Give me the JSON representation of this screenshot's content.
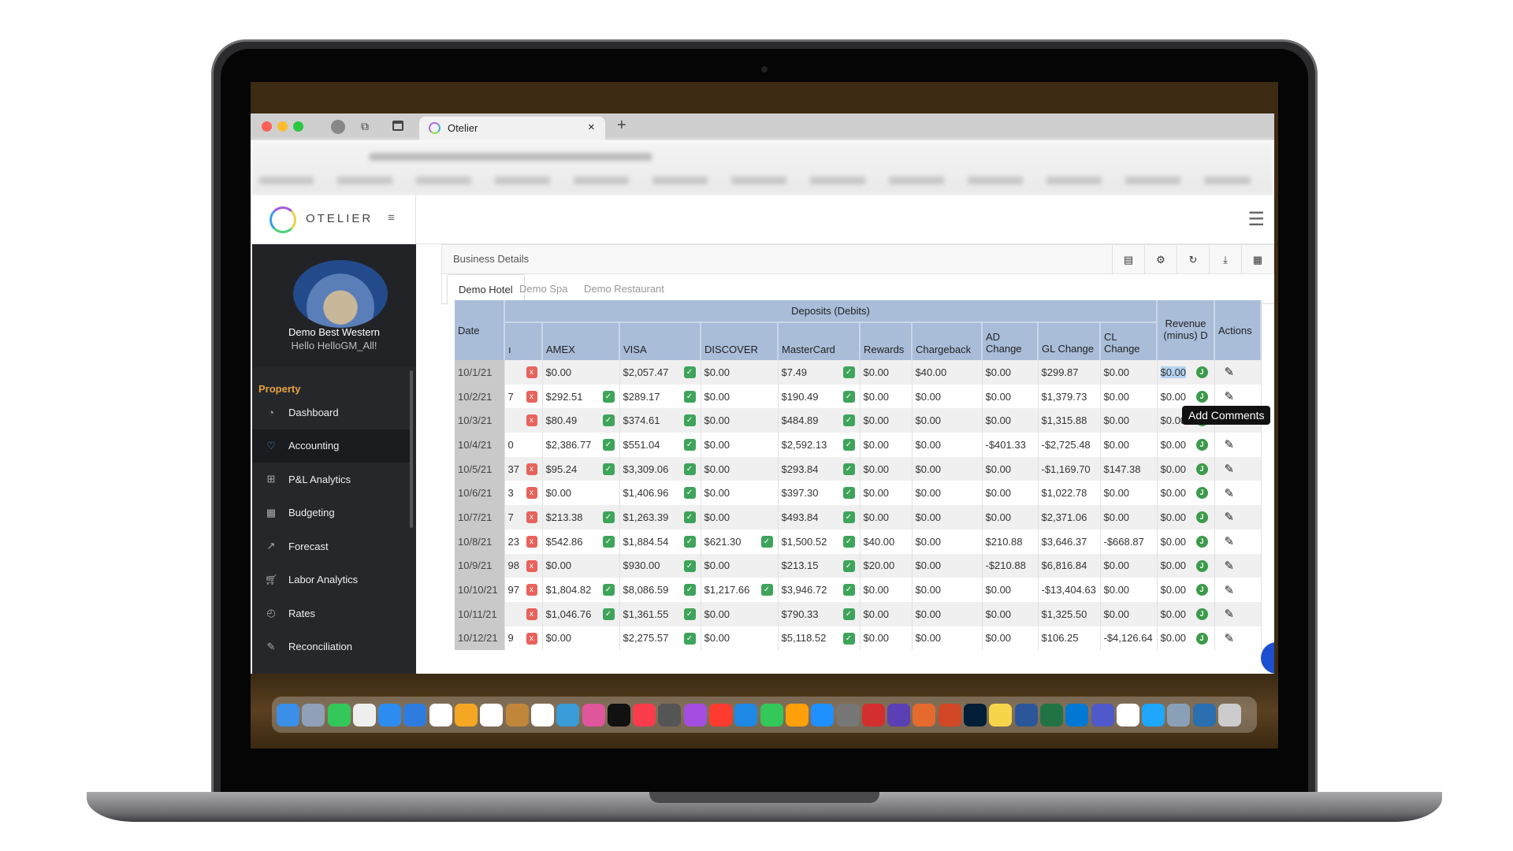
{
  "browser": {
    "tab_title": "Otelier",
    "close": "×",
    "new_tab": "+"
  },
  "app": {
    "logo_text": "OTELIER",
    "menu_icon": "≡"
  },
  "sidebar": {
    "property_name": "Demo Best Western",
    "greeting": "Hello HelloGM_All!",
    "section": "Property",
    "items": [
      {
        "label": "Dashboard",
        "icon": "gauge-icon"
      },
      {
        "label": "Accounting",
        "icon": "handshake-icon",
        "active": true
      },
      {
        "label": "P&L Analytics",
        "icon": "gift-icon"
      },
      {
        "label": "Budgeting",
        "icon": "grid-icon"
      },
      {
        "label": "Forecast",
        "icon": "chart-line-icon"
      },
      {
        "label": "Labor Analytics",
        "icon": "cart-icon"
      },
      {
        "label": "Rates",
        "icon": "pie-icon"
      },
      {
        "label": "Reconciliation",
        "icon": "edit-icon"
      }
    ]
  },
  "panel": {
    "title": "Business Details",
    "tabs": [
      "Demo Hotel",
      "Demo Spa",
      "Demo Restaurant"
    ],
    "active_tab": "Demo Hotel"
  },
  "table": {
    "group_header": "Deposits (Debits)",
    "headers": {
      "date": "Date",
      "partial": "ı",
      "amex": "AMEX",
      "visa": "VISA",
      "discover": "DISCOVER",
      "mastercard": "MasterCard",
      "rewards": "Rewards",
      "chargeback": "Chargeback",
      "ad": "AD Change",
      "gl": "GL Change",
      "cl": "CL Change",
      "revenue": "Revenue (minus) D",
      "actions": "Actions"
    },
    "rows": [
      {
        "date": "10/1/21",
        "p": "",
        "px": true,
        "amex": "$0.00",
        "amex_ok": false,
        "visa": "$2,057.47",
        "visa_ok": true,
        "disc": "$0.00",
        "disc_ok": false,
        "mc": "$7.49",
        "mc_ok": true,
        "rewards": "$0.00",
        "cb": "$40.00",
        "ad": "$0.00",
        "gl": "$299.87",
        "cl": "$0.00",
        "rev": "$0.00"
      },
      {
        "date": "10/2/21",
        "p": "7",
        "px": true,
        "amex": "$292.51",
        "amex_ok": true,
        "visa": "$289.17",
        "visa_ok": true,
        "disc": "$0.00",
        "disc_ok": false,
        "mc": "$190.49",
        "mc_ok": true,
        "rewards": "$0.00",
        "cb": "$0.00",
        "ad": "$0.00",
        "gl": "$1,379.73",
        "cl": "$0.00",
        "rev": "$0.00"
      },
      {
        "date": "10/3/21",
        "p": "",
        "px": true,
        "amex": "$80.49",
        "amex_ok": true,
        "visa": "$374.61",
        "visa_ok": true,
        "disc": "$0.00",
        "disc_ok": false,
        "mc": "$484.89",
        "mc_ok": true,
        "rewards": "$0.00",
        "cb": "$0.00",
        "ad": "$0.00",
        "gl": "$1,315.88",
        "cl": "$0.00",
        "rev": "$0.00"
      },
      {
        "date": "10/4/21",
        "p": "0",
        "px": false,
        "amex": "$2,386.77",
        "amex_ok": true,
        "visa": "$551.04",
        "visa_ok": true,
        "disc": "$0.00",
        "disc_ok": false,
        "mc": "$2,592.13",
        "mc_ok": true,
        "rewards": "$0.00",
        "cb": "$0.00",
        "ad": "-$401.33",
        "gl": "-$2,725.48",
        "cl": "$0.00",
        "rev": "$0.00"
      },
      {
        "date": "10/5/21",
        "p": "37",
        "px": true,
        "amex": "$95.24",
        "amex_ok": true,
        "visa": "$3,309.06",
        "visa_ok": true,
        "disc": "$0.00",
        "disc_ok": false,
        "mc": "$293.84",
        "mc_ok": true,
        "rewards": "$0.00",
        "cb": "$0.00",
        "ad": "$0.00",
        "gl": "-$1,169.70",
        "cl": "$147.38",
        "rev": "$0.00"
      },
      {
        "date": "10/6/21",
        "p": "3",
        "px": true,
        "amex": "$0.00",
        "amex_ok": false,
        "visa": "$1,406.96",
        "visa_ok": true,
        "disc": "$0.00",
        "disc_ok": false,
        "mc": "$397.30",
        "mc_ok": true,
        "rewards": "$0.00",
        "cb": "$0.00",
        "ad": "$0.00",
        "gl": "$1,022.78",
        "cl": "$0.00",
        "rev": "$0.00"
      },
      {
        "date": "10/7/21",
        "p": "7",
        "px": true,
        "amex": "$213.38",
        "amex_ok": true,
        "visa": "$1,263.39",
        "visa_ok": true,
        "disc": "$0.00",
        "disc_ok": false,
        "mc": "$493.84",
        "mc_ok": true,
        "rewards": "$0.00",
        "cb": "$0.00",
        "ad": "$0.00",
        "gl": "$2,371.06",
        "cl": "$0.00",
        "rev": "$0.00"
      },
      {
        "date": "10/8/21",
        "p": "23",
        "px": true,
        "amex": "$542.86",
        "amex_ok": true,
        "visa": "$1,884.54",
        "visa_ok": true,
        "disc": "$621.30",
        "disc_ok": true,
        "mc": "$1,500.52",
        "mc_ok": true,
        "rewards": "$40.00",
        "cb": "$0.00",
        "ad": "$210.88",
        "gl": "$3,646.37",
        "cl": "-$668.87",
        "rev": "$0.00"
      },
      {
        "date": "10/9/21",
        "p": "98",
        "px": true,
        "amex": "$0.00",
        "amex_ok": false,
        "visa": "$930.00",
        "visa_ok": true,
        "disc": "$0.00",
        "disc_ok": false,
        "mc": "$213.15",
        "mc_ok": true,
        "rewards": "$20.00",
        "cb": "$0.00",
        "ad": "-$210.88",
        "gl": "$6,816.84",
        "cl": "$0.00",
        "rev": "$0.00"
      },
      {
        "date": "10/10/21",
        "p": "97",
        "px": true,
        "amex": "$1,804.82",
        "amex_ok": true,
        "visa": "$8,086.59",
        "visa_ok": true,
        "disc": "$1,217.66",
        "disc_ok": true,
        "mc": "$3,946.72",
        "mc_ok": true,
        "rewards": "$0.00",
        "cb": "$0.00",
        "ad": "$0.00",
        "gl": "-$13,404.63",
        "cl": "$0.00",
        "rev": "$0.00"
      },
      {
        "date": "10/11/21",
        "p": "",
        "px": true,
        "amex": "$1,046.76",
        "amex_ok": true,
        "visa": "$1,361.55",
        "visa_ok": true,
        "disc": "$0.00",
        "disc_ok": false,
        "mc": "$790.33",
        "mc_ok": true,
        "rewards": "$0.00",
        "cb": "$0.00",
        "ad": "$0.00",
        "gl": "$1,325.50",
        "cl": "$0.00",
        "rev": "$0.00"
      },
      {
        "date": "10/12/21",
        "p": "9",
        "px": true,
        "amex": "$0.00",
        "amex_ok": false,
        "visa": "$2,275.57",
        "visa_ok": true,
        "disc": "$0.00",
        "disc_ok": false,
        "mc": "$5,118.52",
        "mc_ok": true,
        "rewards": "$0.00",
        "cb": "$0.00",
        "ad": "$0.00",
        "gl": "$106.25",
        "cl": "-$4,126.64",
        "rev": "$0.00"
      }
    ]
  },
  "tooltip": "Add Comments",
  "colors": {
    "header": "#a9bdd9",
    "check": "#3fa45b",
    "cross": "#e8625c",
    "sidebar": "#222327",
    "accent": "#e8a23c"
  },
  "dock": [
    "#3b8fe8",
    "#8fa0b8",
    "#34c759",
    "#eeeeee",
    "#2d8cf0",
    "#2f7ce0",
    "#ffffff",
    "#f5a623",
    "#ffffff",
    "#c0873a",
    "#ffffff",
    "#3a9bd9",
    "#e0569b",
    "#111111",
    "#fa3c4c",
    "#555555",
    "#a34ee0",
    "#ff3b30",
    "#1e88e5",
    "#34c759",
    "#ff9f0a",
    "#1e90ff",
    "#777777",
    "#d32f2f",
    "#5b3fb5",
    "#e56a2e",
    "#d24726",
    "#001e36",
    "#f7d54a",
    "#2b579a",
    "#217346",
    "#0078d4",
    "#5059c9",
    "#ffffff",
    "#1ea7fd",
    "#8aa0b6",
    "#2a6fb0",
    "#cccccc"
  ]
}
